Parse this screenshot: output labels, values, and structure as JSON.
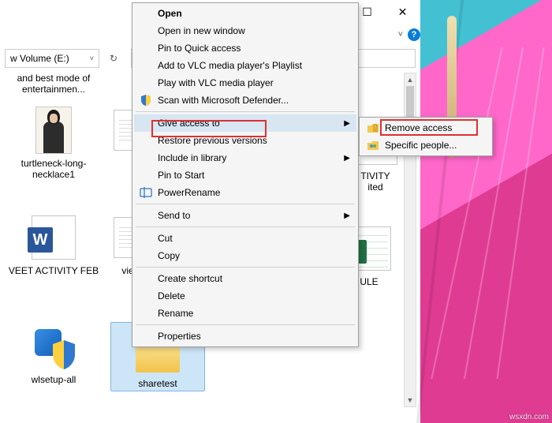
{
  "window": {
    "close_glyph": "✕",
    "max_glyph": "☐",
    "chevron_glyph": "˅",
    "help_glyph": "?"
  },
  "address": {
    "path_text": "w Volume (E:)",
    "chev": "˅",
    "refresh_glyph": "↻"
  },
  "files": [
    {
      "name": "and best mode of entertainmen...",
      "kind": "paper"
    },
    {
      "name": "turtleneck-long-necklace1",
      "kind": "photo"
    },
    {
      "name": "VEET ACTIVITY FEB",
      "kind": "word"
    },
    {
      "name": "wlsetup-all",
      "kind": "exec"
    },
    {
      "name": "vie",
      "kind": "paper2"
    },
    {
      "name": "sharetest",
      "kind": "folder"
    },
    {
      "name": "TIVITY\nited",
      "kind": "excel-right1"
    },
    {
      "name": "ULE",
      "kind": "excel-right2"
    }
  ],
  "context_menu": {
    "items": [
      {
        "label": "Open",
        "bold": true
      },
      {
        "label": "Open in new window"
      },
      {
        "label": "Pin to Quick access"
      },
      {
        "label": "Add to VLC media player's Playlist"
      },
      {
        "label": "Play with VLC media player"
      },
      {
        "label": "Scan with Microsoft Defender...",
        "icon": "shield"
      },
      {
        "sep": true
      },
      {
        "label": "Give access to",
        "submenu": true,
        "highlight": true
      },
      {
        "label": "Restore previous versions"
      },
      {
        "label": "Include in library",
        "submenu": true
      },
      {
        "label": "Pin to Start"
      },
      {
        "label": "PowerRename",
        "icon": "rename"
      },
      {
        "sep": true
      },
      {
        "label": "Send to",
        "submenu": true
      },
      {
        "sep": true
      },
      {
        "label": "Cut"
      },
      {
        "label": "Copy"
      },
      {
        "sep": true
      },
      {
        "label": "Create shortcut"
      },
      {
        "label": "Delete"
      },
      {
        "label": "Rename"
      },
      {
        "sep": true
      },
      {
        "label": "Properties"
      }
    ]
  },
  "submenu": {
    "items": [
      {
        "label": "Remove access",
        "icon": "lock",
        "highlight": true
      },
      {
        "label": "Specific people...",
        "icon": "people"
      }
    ]
  },
  "watermark": "wsxdn.com"
}
